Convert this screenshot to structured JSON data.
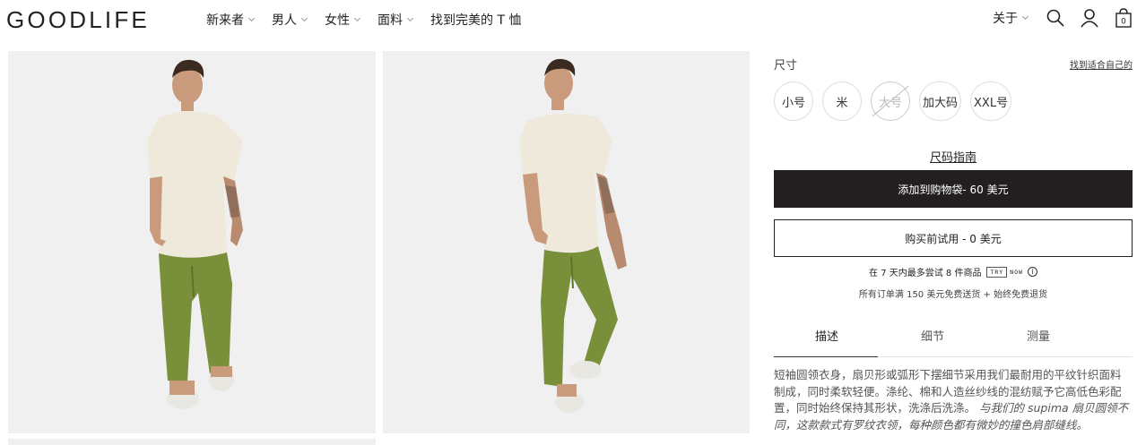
{
  "header": {
    "logo": "GOODLIFE",
    "nav": [
      {
        "label": "新来者",
        "has_dropdown": true
      },
      {
        "label": "男人",
        "has_dropdown": true
      },
      {
        "label": "女性",
        "has_dropdown": true
      },
      {
        "label": "面料",
        "has_dropdown": true
      },
      {
        "label": "找到完美的 T 恤",
        "has_dropdown": false
      }
    ],
    "about": "关于",
    "icons": [
      "search-icon",
      "account-icon",
      "cart-icon"
    ],
    "cart_count": "0"
  },
  "gallery": {
    "images": [
      "model-front-view",
      "model-three-quarter-view"
    ]
  },
  "product": {
    "size_label": "尺寸",
    "fit_link": "找到适合自己的",
    "sizes": [
      {
        "label": "小号",
        "available": true
      },
      {
        "label": "米",
        "available": true
      },
      {
        "label": "大号",
        "available": false
      },
      {
        "label": "加大码",
        "available": true
      },
      {
        "label": "XXL号",
        "available": true
      }
    ],
    "size_guide": "尺码指南",
    "add_to_bag": "添加到购物袋- 60 美元",
    "try_before": "购买前试用 - 0 美元",
    "try_note_prefix": "在 7 天内最多尝试 8 件商品",
    "try_badge": "TRY",
    "try_badge_now": "NOW",
    "info_glyph": "i",
    "shipping_note": "所有订单满 150 美元免费送货 + 始终免费退货",
    "tabs": [
      {
        "label": "描述",
        "active": true
      },
      {
        "label": "细节",
        "active": false
      },
      {
        "label": "测量",
        "active": false
      }
    ],
    "description_main": "短袖圆领衣身，扇贝形或弧形下摆细节采用我们最耐用的平纹针织面料制成，同时柔软轻便。涤纶、棉和人造丝纱线的混纺赋予它高低色彩配置，同时始终保持其形状，洗涤后洗涤。",
    "description_italic": "与我们的 supima 扇贝圆领不同，这款款式有罗纹衣领，每种颜色都有微妙的撞色肩部缝线。"
  },
  "colors": {
    "accent_dark": "#231f20",
    "photo_bg": "#f0f0f0",
    "shirt": "#efe9dc",
    "pants": "#7a8f3a"
  }
}
